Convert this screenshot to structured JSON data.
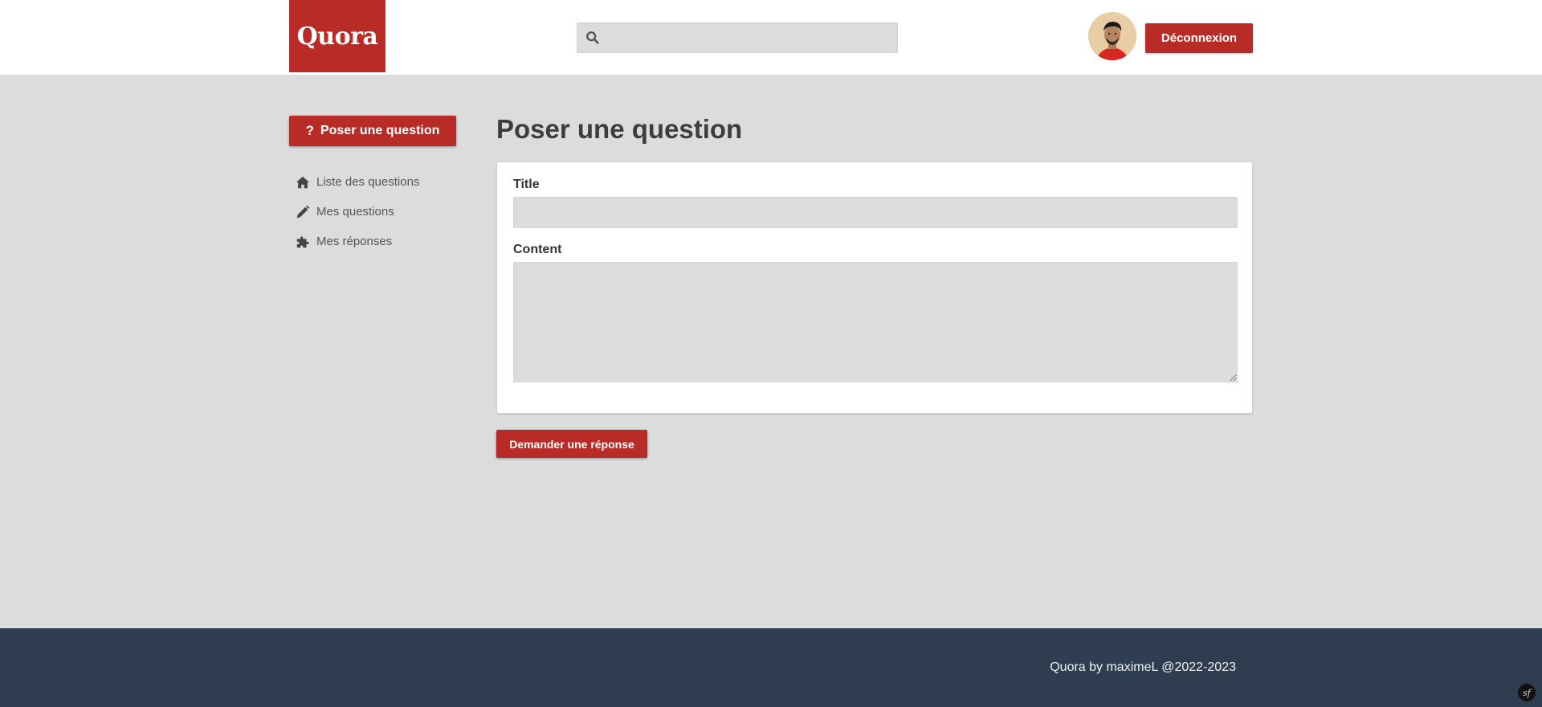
{
  "header": {
    "logo_text": "Quora",
    "search": {
      "icon": "search-icon",
      "value": "",
      "placeholder": ""
    },
    "avatar": {
      "icon": "user-avatar"
    },
    "logout_label": "Déconnexion"
  },
  "sidebar": {
    "ask_button": {
      "icon": "question-mark-icon",
      "label": "Poser une question"
    },
    "items": [
      {
        "icon": "home-icon",
        "label": "Liste des questions"
      },
      {
        "icon": "pencil-icon",
        "label": "Mes questions"
      },
      {
        "icon": "puzzle-icon",
        "label": "Mes réponses"
      }
    ]
  },
  "main": {
    "title": "Poser une question",
    "form": {
      "title_label": "Title",
      "title_value": "",
      "content_label": "Content",
      "content_value": ""
    },
    "submit_label": "Demander une réponse"
  },
  "footer": {
    "text": "Quora by maximeL @2022-2023",
    "badge_icon": "symfony-icon",
    "badge_text": "sf"
  },
  "colors": {
    "brand": "#b92b27",
    "background": "#dcdcdc",
    "footer": "#2e3e50"
  }
}
